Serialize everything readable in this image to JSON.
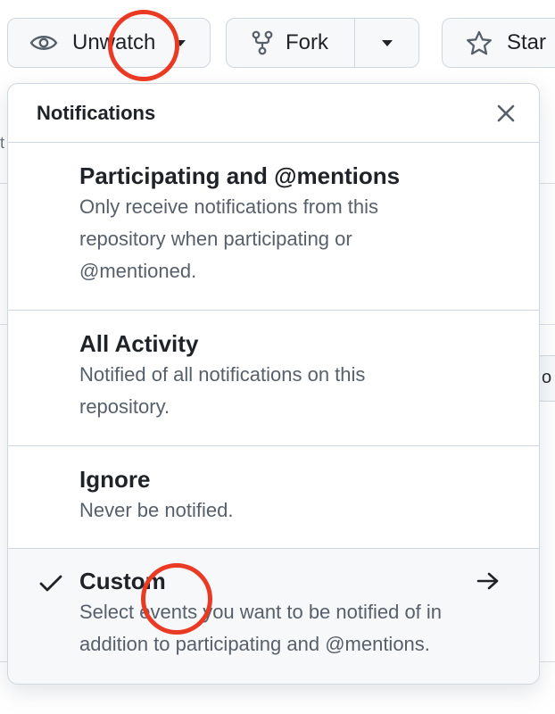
{
  "topbar": {
    "watch": {
      "label": "Unwatch",
      "icon": "eye-icon"
    },
    "fork": {
      "label": "Fork",
      "icon": "repo-forked-icon"
    },
    "star": {
      "label": "Star",
      "icon": "star-icon"
    }
  },
  "panel": {
    "title": "Notifications",
    "options": [
      {
        "title": "Participating and @mentions",
        "desc_lines": [
          "Only receive notifications from this",
          "repository when participating or",
          "@mentioned."
        ],
        "selected": false
      },
      {
        "title": "All Activity",
        "desc_lines": [
          "Notified of all notifications on this",
          "repository."
        ],
        "selected": false
      },
      {
        "title": "Ignore",
        "desc_lines": [
          "Never be notified."
        ],
        "selected": false
      },
      {
        "title": "Custom",
        "desc_lines": [
          "Select events you want to be notified of in",
          "addition to participating and @mentions."
        ],
        "selected": true
      }
    ]
  },
  "background": {
    "edge_char_left": "t",
    "edge_pill_text": "o"
  },
  "colors": {
    "annotation_red": "#ea3a24",
    "border": "#d0d7de",
    "text": "#1f2328",
    "muted": "#57606a",
    "selected_bg": "#f6f8fa"
  }
}
